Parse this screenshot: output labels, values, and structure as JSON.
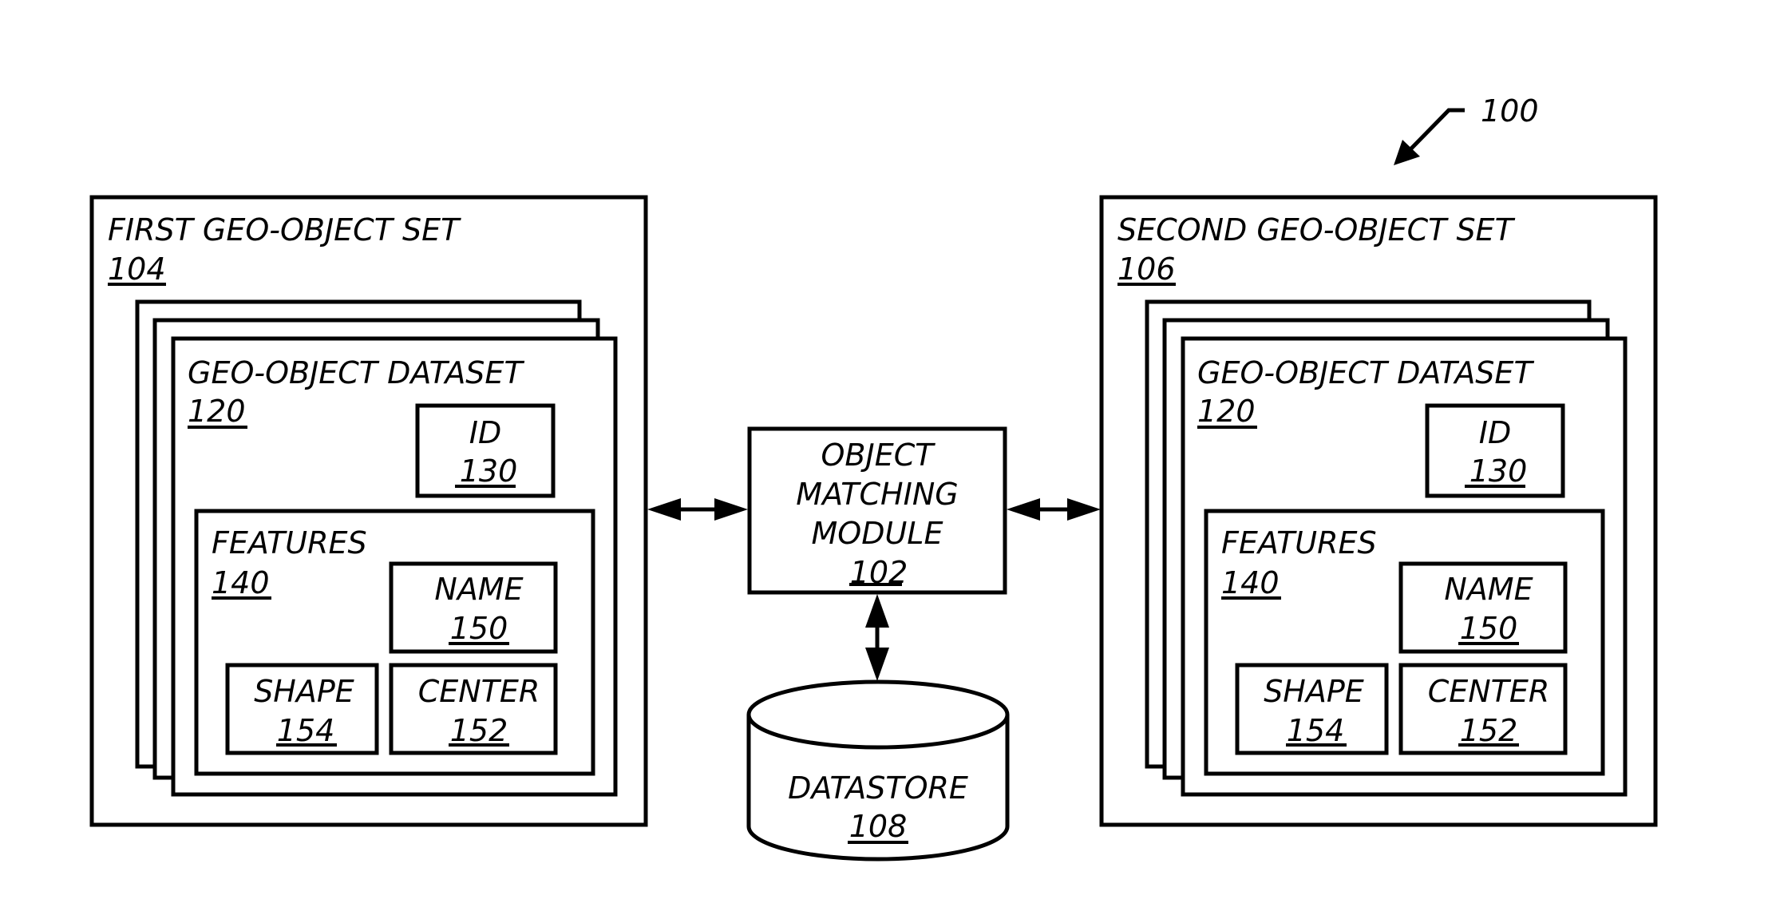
{
  "figure": {
    "reference": "100"
  },
  "first_set": {
    "title": "FIRST GEO-OBJECT SET",
    "ref": "104",
    "dataset": {
      "title": "GEO-OBJECT DATASET",
      "ref": "120",
      "id_box": {
        "title": "ID",
        "ref": "130"
      },
      "features": {
        "title": "FEATURES",
        "ref": "140",
        "name_box": {
          "title": "NAME",
          "ref": "150"
        },
        "shape_box": {
          "title": "SHAPE",
          "ref": "154"
        },
        "center_box": {
          "title": "CENTER",
          "ref": "152"
        }
      }
    }
  },
  "second_set": {
    "title": "SECOND GEO-OBJECT SET",
    "ref": "106",
    "dataset": {
      "title": "GEO-OBJECT DATASET",
      "ref": "120",
      "id_box": {
        "title": "ID",
        "ref": "130"
      },
      "features": {
        "title": "FEATURES",
        "ref": "140",
        "name_box": {
          "title": "NAME",
          "ref": "150"
        },
        "shape_box": {
          "title": "SHAPE",
          "ref": "154"
        },
        "center_box": {
          "title": "CENTER",
          "ref": "152"
        }
      }
    }
  },
  "module": {
    "lines": [
      "OBJECT",
      "MATCHING",
      "MODULE"
    ],
    "ref": "102"
  },
  "datastore": {
    "title": "DATASTORE",
    "ref": "108"
  },
  "connections": [
    {
      "from": "first_set",
      "to": "module",
      "type": "bidirectional"
    },
    {
      "from": "module",
      "to": "second_set",
      "type": "bidirectional"
    },
    {
      "from": "module",
      "to": "datastore",
      "type": "bidirectional"
    }
  ]
}
